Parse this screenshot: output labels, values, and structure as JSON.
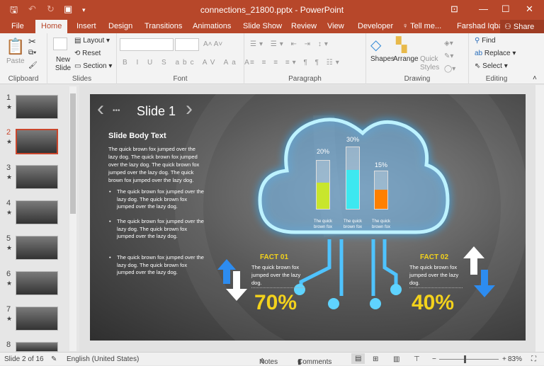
{
  "window": {
    "title": "connections_21800.pptx - PowerPoint",
    "user": "Farshad Iqbal",
    "share": "Share"
  },
  "tabs": [
    "File",
    "Home",
    "Insert",
    "Design",
    "Transitions",
    "Animations",
    "Slide Show",
    "Review",
    "View",
    "Developer",
    "Tell me..."
  ],
  "ribbon": {
    "clipboard": {
      "label": "Clipboard",
      "paste": "Paste"
    },
    "slides": {
      "label": "Slides",
      "new_slide": "New Slide",
      "layout": "Layout",
      "reset": "Reset",
      "section": "Section"
    },
    "font": {
      "label": "Font"
    },
    "paragraph": {
      "label": "Paragraph"
    },
    "drawing": {
      "label": "Drawing",
      "shapes": "Shapes",
      "arrange": "Arrange",
      "quick_styles": "Quick Styles"
    },
    "editing": {
      "label": "Editing",
      "find": "Find",
      "replace": "Replace",
      "select": "Select"
    }
  },
  "thumbnails": [
    "1",
    "2",
    "3",
    "4",
    "5",
    "6",
    "7",
    "8"
  ],
  "selected_slide": 2,
  "slide": {
    "title": "Slide 1",
    "heading": "Slide Body Text",
    "body": "The quick brown fox jumped over the lazy dog. The quick brown fox jumped over the lazy dog. The quick brown fox jumped over the lazy dog. The quick brown fox jumped over the lazy dog.",
    "bullets": [
      "The quick brown fox jumped over the lazy dog. The quick brown fox jumped over the lazy dog.",
      "The quick brown fox jumped over the lazy dog. The quick brown fox jumped over the lazy dog.",
      "The quick brown fox jumped over the lazy dog. The quick brown fox jumped over the lazy dog."
    ],
    "bars": [
      {
        "label": "20%",
        "value": 20,
        "caption": "The quick brown fox",
        "color": "#c8e62d"
      },
      {
        "label": "30%",
        "value": 30,
        "caption": "The quick brown fox",
        "color": "#3de8f0"
      },
      {
        "label": "15%",
        "value": 15,
        "caption": "The quick brown fox",
        "color": "#ff8000"
      }
    ],
    "facts": [
      {
        "title": "FACT 01",
        "text": "The quick brown fox jumped over the lazy dog.",
        "percent": "70%"
      },
      {
        "title": "FACT 02",
        "text": "The quick brown fox jumped over the lazy dog.",
        "percent": "40%"
      }
    ]
  },
  "status": {
    "slide": "Slide 2 of 16",
    "language": "English (United States)",
    "notes": "Notes",
    "comments": "Comments",
    "zoom": "83%",
    "zoom_value": 83
  }
}
